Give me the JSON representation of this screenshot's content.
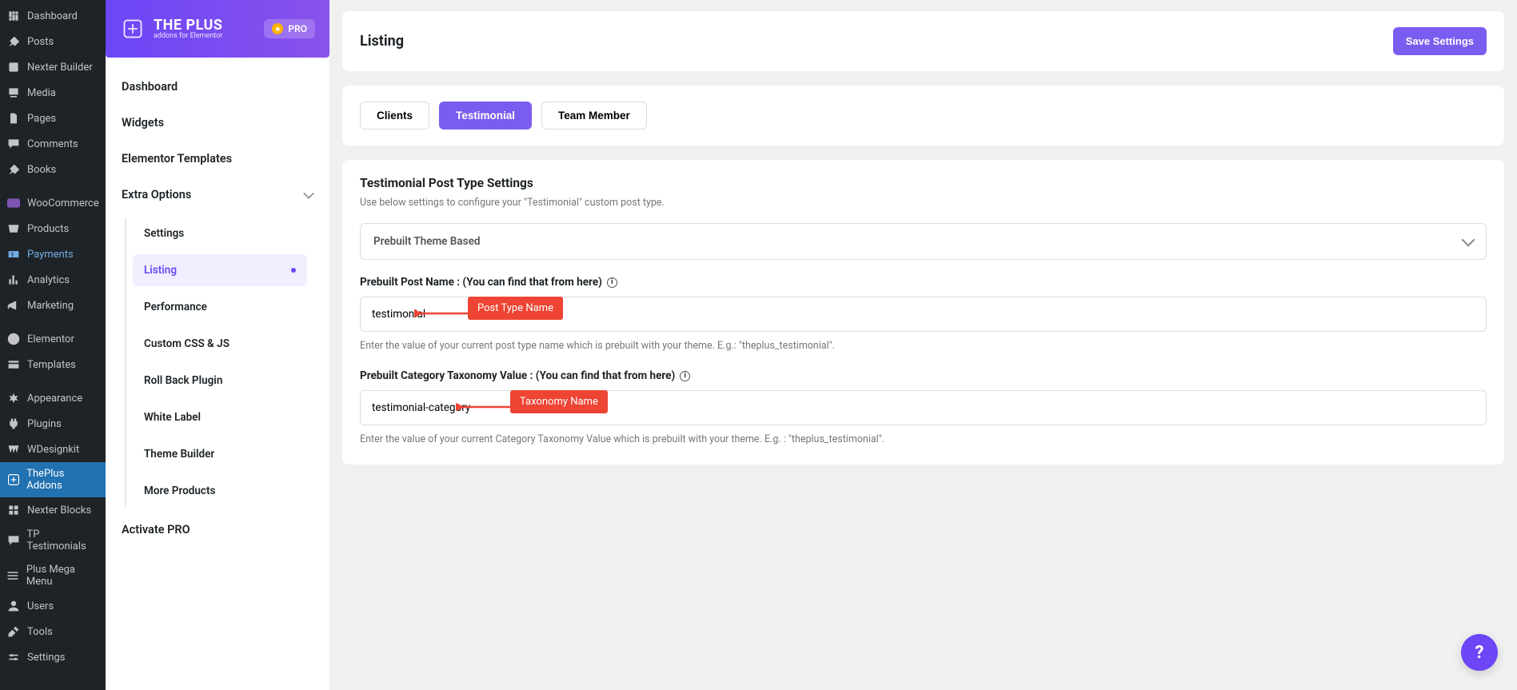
{
  "wp_nav": {
    "items": [
      {
        "icon": "dashboard",
        "label": "Dashboard"
      },
      {
        "icon": "pin",
        "label": "Posts"
      },
      {
        "icon": "nexter",
        "label": "Nexter Builder"
      },
      {
        "icon": "media",
        "label": "Media"
      },
      {
        "icon": "page",
        "label": "Pages"
      },
      {
        "icon": "comment",
        "label": "Comments"
      },
      {
        "icon": "pin",
        "label": "Books"
      },
      {
        "icon": "woo",
        "label": "WooCommerce",
        "gap": true
      },
      {
        "icon": "product",
        "label": "Products"
      },
      {
        "icon": "payments",
        "label": "Payments",
        "highlight": true
      },
      {
        "icon": "analytics",
        "label": "Analytics"
      },
      {
        "icon": "marketing",
        "label": "Marketing"
      },
      {
        "icon": "elementor",
        "label": "Elementor",
        "gap": true
      },
      {
        "icon": "templates",
        "label": "Templates"
      },
      {
        "icon": "appearance",
        "label": "Appearance",
        "gap": true
      },
      {
        "icon": "plugins",
        "label": "Plugins"
      },
      {
        "icon": "wdesign",
        "label": "WDesignkit"
      },
      {
        "icon": "theplus",
        "label": "ThePlus Addons",
        "current": true
      },
      {
        "icon": "nexterb",
        "label": "Nexter Blocks"
      },
      {
        "icon": "tptest",
        "label": "TP Testimonials"
      },
      {
        "icon": "mega",
        "label": "Plus Mega Menu"
      },
      {
        "icon": "users",
        "label": "Users"
      },
      {
        "icon": "tools",
        "label": "Tools"
      },
      {
        "icon": "settings",
        "label": "Settings"
      }
    ]
  },
  "tp_sidebar": {
    "brand_title": "THE PLUS",
    "brand_sub": "addons for Elementor",
    "pro_label": "PRO",
    "menu": [
      {
        "label": "Dashboard"
      },
      {
        "label": "Widgets"
      },
      {
        "label": "Elementor Templates"
      },
      {
        "label": "Extra Options",
        "expandable": true,
        "expanded": true,
        "children": [
          {
            "label": "Settings"
          },
          {
            "label": "Listing",
            "active": true
          },
          {
            "label": "Performance"
          },
          {
            "label": "Custom CSS & JS"
          },
          {
            "label": "Roll Back Plugin"
          },
          {
            "label": "White Label"
          },
          {
            "label": "Theme Builder"
          },
          {
            "label": "More Products"
          }
        ]
      },
      {
        "label": "Activate PRO"
      }
    ]
  },
  "main": {
    "title": "Listing",
    "save_label": "Save Settings",
    "tabs": [
      {
        "label": "Clients"
      },
      {
        "label": "Testimonial",
        "active": true
      },
      {
        "label": "Team Member"
      }
    ],
    "section_title": "Testimonial Post Type Settings",
    "section_sub": "Use below settings to configure your \"Testimonial\" custom post type.",
    "select_value": "Prebuilt Theme Based",
    "field1_label": "Prebuilt Post Name : (You can find that from here)",
    "field1_value": "testimonial",
    "field1_help": "Enter the value of your current post type name which is prebuilt with your theme. E.g.: \"theplus_testimonial\".",
    "field1_callout": "Post Type Name",
    "field2_label": "Prebuilt Category Taxonomy Value : (You can find that from here)",
    "field2_value": "testimonial-category",
    "field2_help": "Enter the value of your current Category Taxonomy Value which is prebuilt with your theme. E.g. : \"theplus_testimonial\".",
    "field2_callout": "Taxonomy Name"
  },
  "fab": "?"
}
